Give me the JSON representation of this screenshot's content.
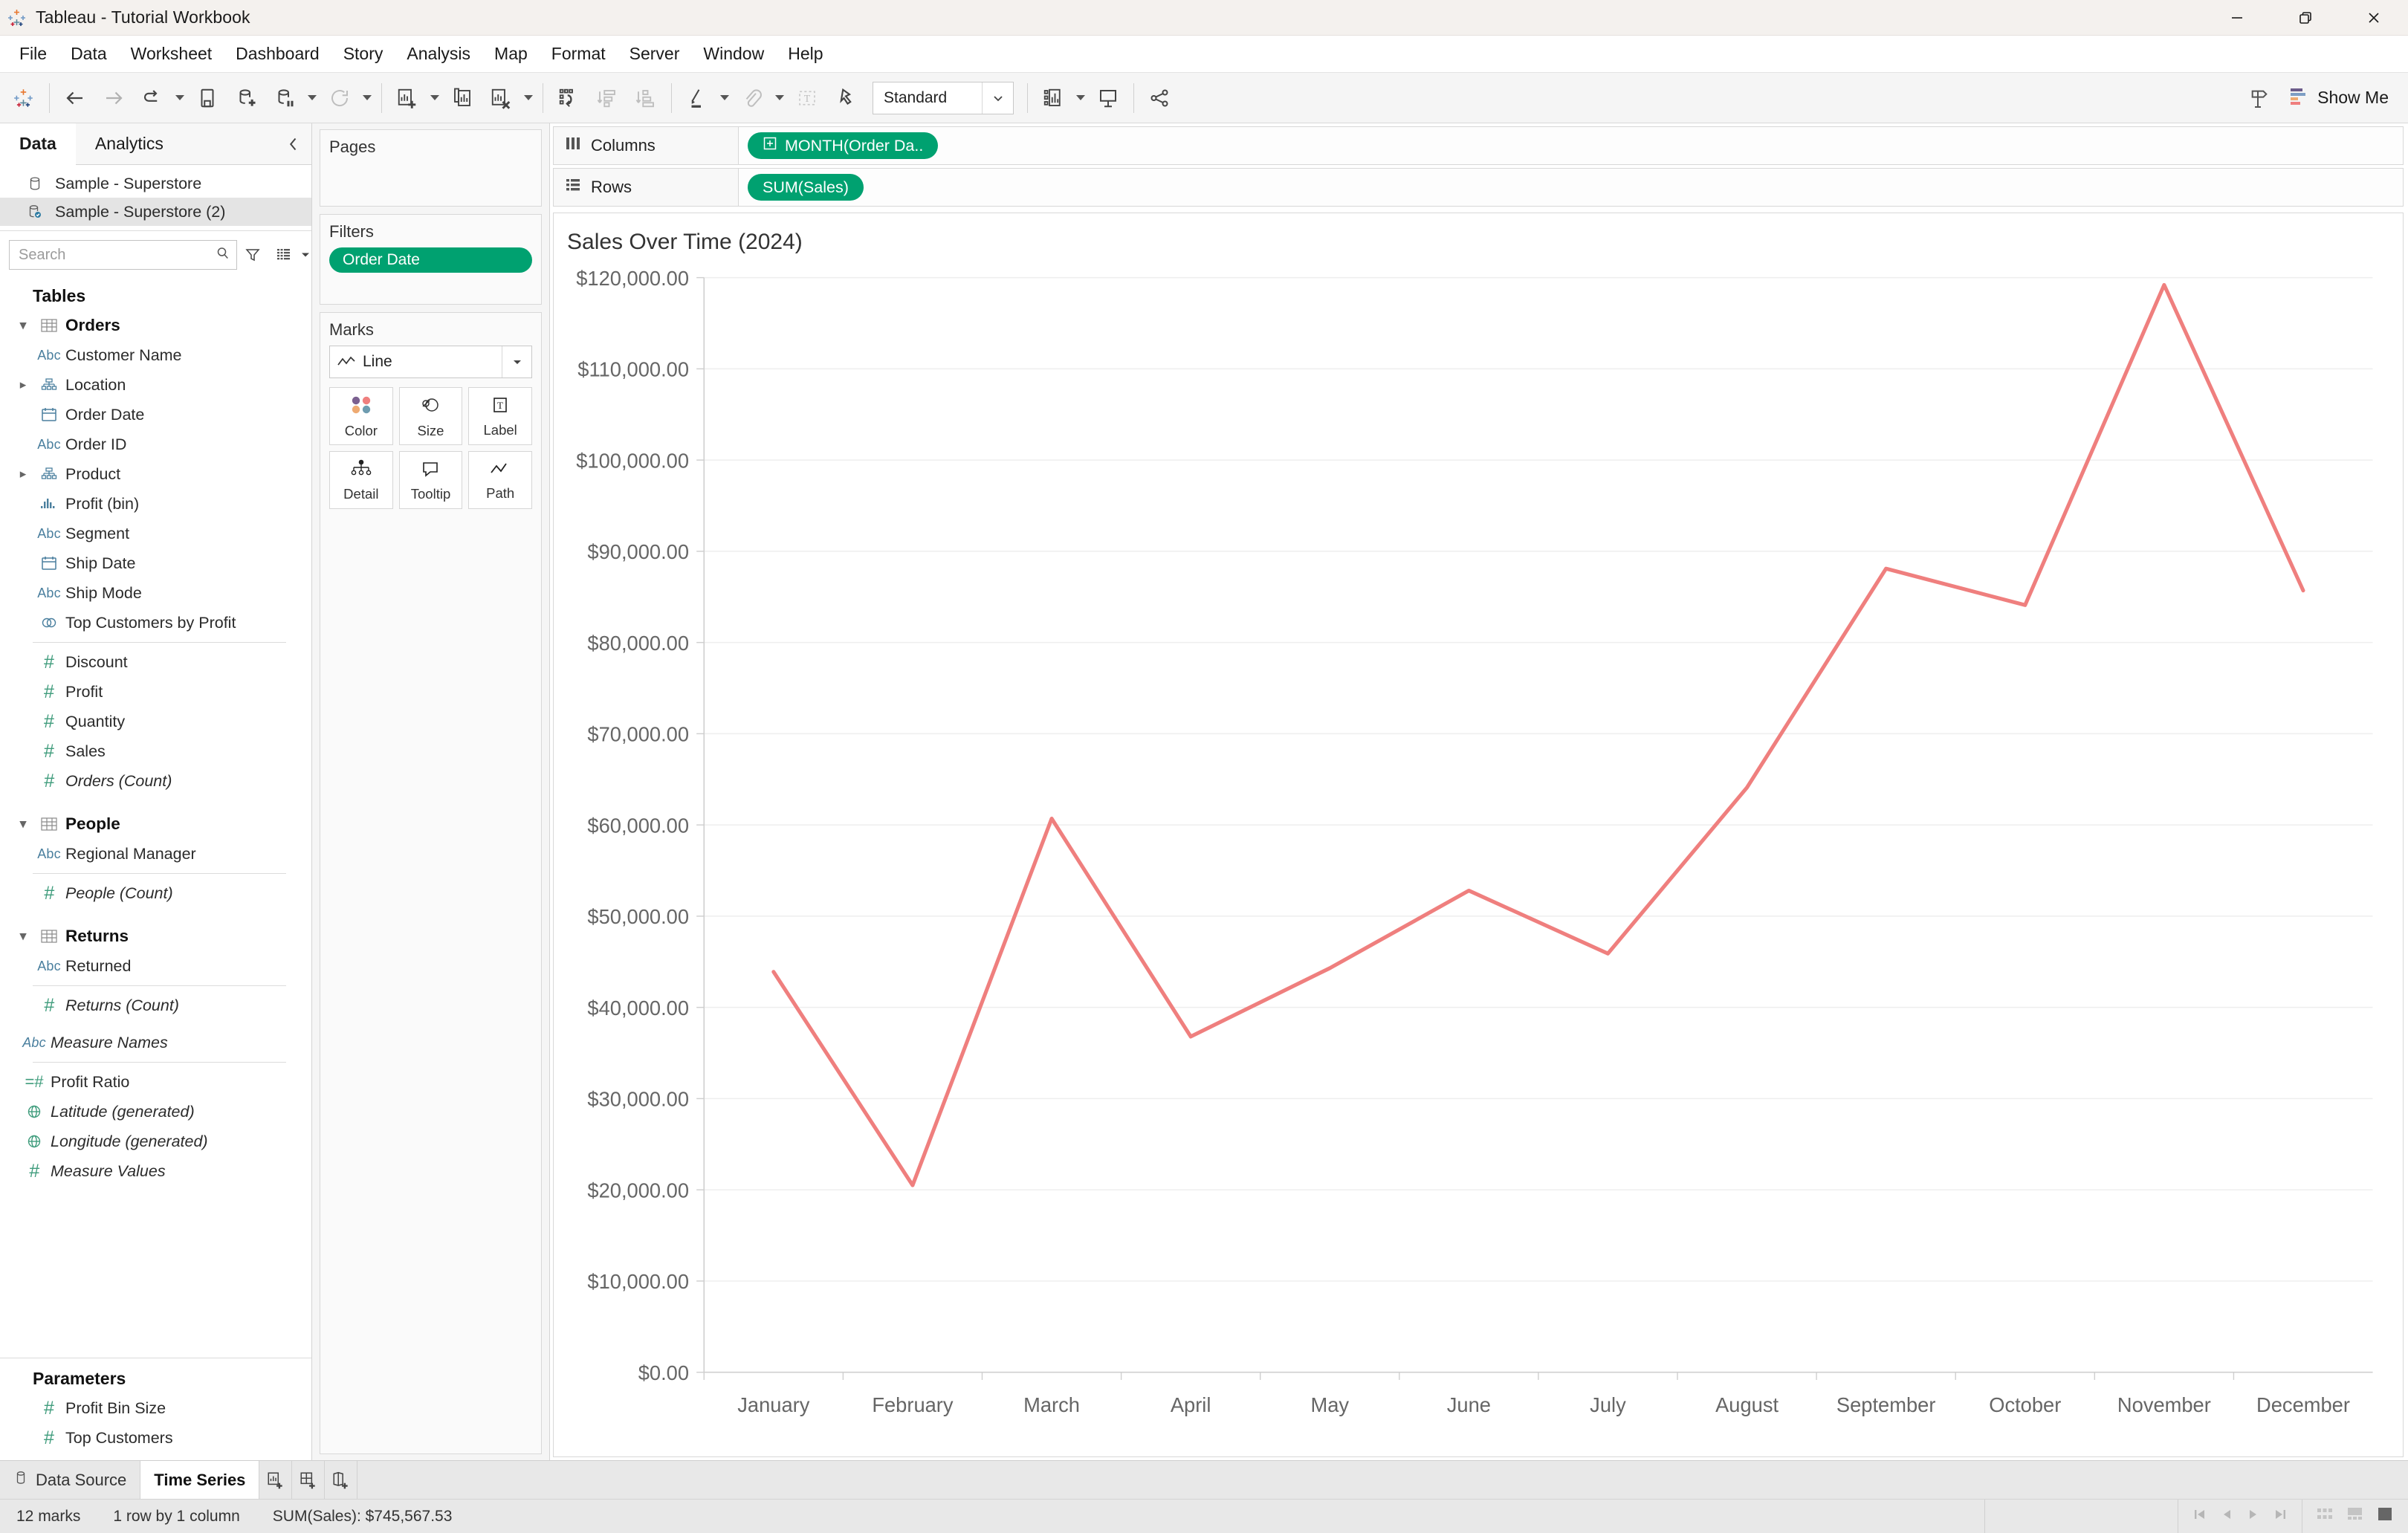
{
  "window": {
    "title": "Tableau - Tutorial Workbook",
    "logo_icon": "tableau-logo-icon",
    "minimize_icon": "minimize-icon",
    "restore_icon": "restore-icon",
    "close_icon": "close-icon"
  },
  "menu": {
    "items": [
      {
        "label": "File"
      },
      {
        "label": "Data"
      },
      {
        "label": "Worksheet"
      },
      {
        "label": "Dashboard"
      },
      {
        "label": "Story"
      },
      {
        "label": "Analysis"
      },
      {
        "label": "Map"
      },
      {
        "label": "Format"
      },
      {
        "label": "Server"
      },
      {
        "label": "Window"
      },
      {
        "label": "Help"
      }
    ]
  },
  "toolbar": {
    "fit_value": "Standard",
    "show_me_label": "Show Me",
    "icons": [
      "tableau-home-icon",
      "back-arrow-icon",
      "forward-arrow-icon",
      "undo-icon",
      "save-icon",
      "add-data-source-icon",
      "pause-refresh-icon",
      "refresh-icon",
      "new-worksheet-icon",
      "duplicate-sheet-icon",
      "clear-sheet-icon",
      "swap-axes-icon",
      "sort-ascending-icon",
      "sort-descending-icon",
      "highlight-icon",
      "group-members-icon",
      "show-labels-icon",
      "fix-axes-icon",
      "presentation-mode-icon",
      "share-icon",
      "showme-signpost-icon",
      "showme-bars-icon"
    ]
  },
  "data_pane": {
    "tabs": [
      {
        "label": "Data",
        "active": true
      },
      {
        "label": "Analytics",
        "active": false
      }
    ],
    "collapse_icon": "chevron-left-icon",
    "data_sources": [
      {
        "label": "Sample - Superstore",
        "icon": "database-icon",
        "selected": false
      },
      {
        "label": "Sample - Superstore (2)",
        "icon": "database-checked-icon",
        "selected": true
      }
    ],
    "search": {
      "placeholder": "Search",
      "search_icon": "search-icon",
      "filter_icon": "filter-funnel-icon",
      "view_icon": "list-view-icon",
      "view_caret_icon": "chevron-down-icon"
    },
    "sections": [
      {
        "title": "Tables"
      },
      {
        "title": "Parameters"
      }
    ],
    "fields": [
      {
        "label": "Orders",
        "icon": "table-icon",
        "type": "table",
        "expander": "chevron-down-icon"
      },
      {
        "label": "Customer Name",
        "icon": "abc-icon",
        "type": "dimension"
      },
      {
        "label": "Location",
        "icon": "hierarchy-icon",
        "type": "hierarchy",
        "expander": "chevron-right-icon"
      },
      {
        "label": "Order Date",
        "icon": "calendar-icon",
        "type": "date"
      },
      {
        "label": "Order ID",
        "icon": "abc-icon",
        "type": "dimension"
      },
      {
        "label": "Product",
        "icon": "hierarchy-icon",
        "type": "hierarchy",
        "expander": "chevron-right-icon"
      },
      {
        "label": "Profit (bin)",
        "icon": "bin-icon",
        "type": "bin"
      },
      {
        "label": "Segment",
        "icon": "abc-icon",
        "type": "dimension"
      },
      {
        "label": "Ship Date",
        "icon": "calendar-icon",
        "type": "date"
      },
      {
        "label": "Ship Mode",
        "icon": "abc-icon",
        "type": "dimension"
      },
      {
        "label": "Top Customers by Profit",
        "icon": "set-icon",
        "type": "set"
      },
      {
        "label": "Discount",
        "icon": "number-icon",
        "type": "measure"
      },
      {
        "label": "Profit",
        "icon": "number-icon",
        "type": "measure"
      },
      {
        "label": "Quantity",
        "icon": "number-icon",
        "type": "measure"
      },
      {
        "label": "Sales",
        "icon": "number-icon",
        "type": "measure"
      },
      {
        "label": "Orders (Count)",
        "icon": "number-icon",
        "type": "measure-italic"
      },
      {
        "label": "People",
        "icon": "table-icon",
        "type": "table",
        "expander": "chevron-down-icon"
      },
      {
        "label": "Regional Manager",
        "icon": "abc-icon",
        "type": "dimension"
      },
      {
        "label": "People (Count)",
        "icon": "number-icon",
        "type": "measure-italic"
      },
      {
        "label": "Returns",
        "icon": "table-icon",
        "type": "table",
        "expander": "chevron-down-icon"
      },
      {
        "label": "Returned",
        "icon": "abc-icon",
        "type": "dimension"
      },
      {
        "label": "Returns (Count)",
        "icon": "number-icon",
        "type": "measure-italic"
      },
      {
        "label": "Measure Names",
        "icon": "abc-icon",
        "type": "dimension-italic"
      },
      {
        "label": "Profit Ratio",
        "icon": "calculated-number-icon",
        "type": "measure"
      },
      {
        "label": "Latitude (generated)",
        "icon": "globe-icon",
        "type": "geo-italic"
      },
      {
        "label": "Longitude (generated)",
        "icon": "globe-icon",
        "type": "geo-italic"
      },
      {
        "label": "Measure Values",
        "icon": "number-icon",
        "type": "measure-italic"
      }
    ],
    "parameters": [
      {
        "label": "Profit Bin Size",
        "icon": "number-icon"
      },
      {
        "label": "Top Customers",
        "icon": "number-icon"
      }
    ]
  },
  "cards": {
    "pages": {
      "title": "Pages"
    },
    "filters": {
      "title": "Filters",
      "pills": [
        {
          "label": "Order Date"
        }
      ]
    },
    "marks": {
      "title": "Marks",
      "mark_type": "Line",
      "mark_type_icon": "line-mark-icon",
      "dropdown_icon": "chevron-down-icon",
      "buttons": [
        {
          "label": "Color",
          "icon": "color-dots-icon"
        },
        {
          "label": "Size",
          "icon": "size-icon"
        },
        {
          "label": "Label",
          "icon": "label-text-icon"
        },
        {
          "label": "Detail",
          "icon": "detail-icon"
        },
        {
          "label": "Tooltip",
          "icon": "tooltip-icon"
        },
        {
          "label": "Path",
          "icon": "path-line-icon"
        }
      ]
    }
  },
  "shelves": {
    "columns": {
      "label": "Columns",
      "icon": "columns-icon",
      "pills": [
        {
          "label": "MONTH(Order Da..",
          "icon": "plus-box-icon"
        }
      ]
    },
    "rows": {
      "label": "Rows",
      "icon": "rows-icon",
      "pills": [
        {
          "label": "SUM(Sales)"
        }
      ]
    }
  },
  "worksheet_tabs": {
    "data_source": {
      "label": "Data Source",
      "icon": "database-icon"
    },
    "sheets": [
      {
        "label": "Time Series",
        "active": true
      }
    ],
    "new_buttons": [
      {
        "icon": "new-worksheet-icon"
      },
      {
        "icon": "new-dashboard-icon"
      },
      {
        "icon": "new-story-icon"
      }
    ]
  },
  "status_bar": {
    "marks": "12 marks",
    "rows_cols": "1 row by 1 column",
    "aggregate": "SUM(Sales): $745,567.53",
    "nav_icons": [
      "first-page-icon",
      "previous-page-icon",
      "next-page-icon",
      "last-page-icon"
    ],
    "view_icons": [
      "grid-view-icon",
      "filmstrip-view-icon",
      "single-view-icon"
    ]
  },
  "colors": {
    "line": "#ef7f7e",
    "pill_green": "#00a170",
    "accent_blue": "#4a7f9e",
    "measure_green": "#3f9c7c",
    "gridline": "#eeeeee",
    "axis_text": "#666666",
    "title_text": "#333333"
  },
  "chart_data": {
    "type": "line",
    "title": "Sales Over Time (2024)",
    "xlabel": "",
    "ylabel": "",
    "categories": [
      "January",
      "February",
      "March",
      "April",
      "May",
      "June",
      "July",
      "August",
      "September",
      "October",
      "November",
      "December"
    ],
    "values": [
      43900,
      20500,
      60700,
      36800,
      44300,
      52800,
      45900,
      64100,
      88100,
      84100,
      119200,
      85700
    ],
    "series": [
      {
        "name": "SUM(Sales)",
        "values": [
          43900,
          20500,
          60700,
          36800,
          44300,
          52800,
          45900,
          64100,
          88100,
          84100,
          119200,
          85700
        ]
      }
    ],
    "ylim": [
      0,
      120000
    ],
    "ytick_values": [
      0,
      10000,
      20000,
      30000,
      40000,
      50000,
      60000,
      70000,
      80000,
      90000,
      100000,
      110000,
      120000
    ],
    "ytick_labels": [
      "$0.00",
      "$10,000.00",
      "$20,000.00",
      "$30,000.00",
      "$40,000.00",
      "$50,000.00",
      "$60,000.00",
      "$70,000.00",
      "$80,000.00",
      "$90,000.00",
      "$100,000.00",
      "$110,000.00",
      "$120,000.00"
    ],
    "grid": true,
    "legend": "none",
    "line_color": "#ef7f7e",
    "line_width": 5,
    "total": "$745,567.53"
  }
}
